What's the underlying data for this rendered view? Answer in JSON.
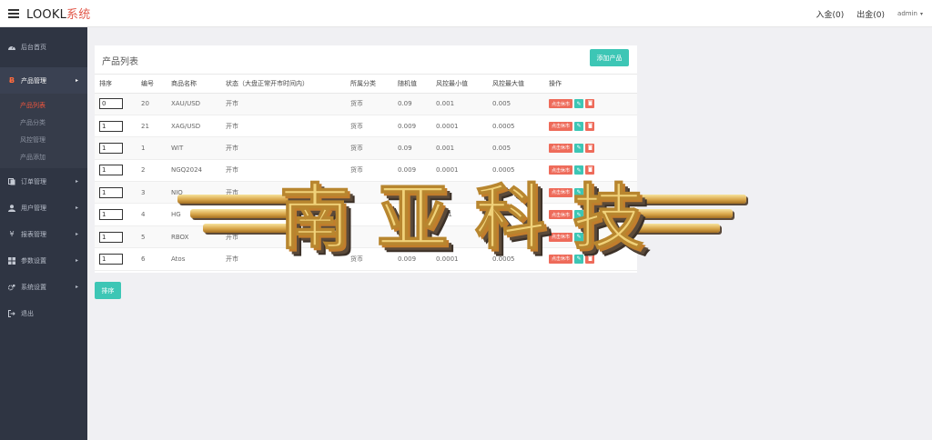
{
  "app": {
    "brand_main": "LOOKL",
    "brand_accent": "系统"
  },
  "topbar": {
    "deposit": "入金(0)",
    "withdraw": "出金(0)",
    "user": "admin"
  },
  "sidebar": {
    "items": [
      {
        "label": "后台首页",
        "icon": "dashboard-icon"
      },
      {
        "label": "产品管理",
        "icon": "bitcoin-icon",
        "active": true,
        "children": [
          {
            "label": "产品列表",
            "current": true
          },
          {
            "label": "产品分类"
          },
          {
            "label": "风控管理"
          },
          {
            "label": "产品添加"
          }
        ]
      },
      {
        "label": "订单管理",
        "icon": "copy-icon"
      },
      {
        "label": "用户管理",
        "icon": "user-icon"
      },
      {
        "label": "报表管理",
        "icon": "yen-icon"
      },
      {
        "label": "参数设置",
        "icon": "grid-icon"
      },
      {
        "label": "系统设置",
        "icon": "gears-icon"
      },
      {
        "label": "退出",
        "icon": "sign-out-icon"
      }
    ]
  },
  "panel": {
    "title": "产品列表",
    "add_button": "添加产品",
    "sort_button": "排序",
    "columns": [
      "排序",
      "编号",
      "商品名称",
      "状态（大盘正常开市时间内）",
      "所属分类",
      "随机值",
      "风控最小值",
      "风控最大值",
      "操作"
    ],
    "rows": [
      {
        "order": "0",
        "id": "20",
        "name": "XAU/USD",
        "status": "开市",
        "category": "货币",
        "random": "0.09",
        "min": "0.001",
        "max": "0.005"
      },
      {
        "order": "1",
        "id": "21",
        "name": "XAG/USD",
        "status": "开市",
        "category": "货币",
        "random": "0.009",
        "min": "0.0001",
        "max": "0.0005"
      },
      {
        "order": "1",
        "id": "1",
        "name": "WIT",
        "status": "开市",
        "category": "货币",
        "random": "0.09",
        "min": "0.001",
        "max": "0.005"
      },
      {
        "order": "1",
        "id": "2",
        "name": "NGQ2024",
        "status": "开市",
        "category": "货币",
        "random": "0.009",
        "min": "0.0001",
        "max": "0.0005"
      },
      {
        "order": "1",
        "id": "3",
        "name": "NIO",
        "status": "开市",
        "category": "",
        "random": "",
        "min": "",
        "max": ""
      },
      {
        "order": "1",
        "id": "4",
        "name": "HG",
        "status": "",
        "category": "",
        "random": "",
        "min": "0001",
        "max": ""
      },
      {
        "order": "1",
        "id": "5",
        "name": "RBOX",
        "status": "开市",
        "category": "",
        "random": "",
        "min": "",
        "max": ""
      },
      {
        "order": "1",
        "id": "6",
        "name": "Atos",
        "status": "开市",
        "category": "货币",
        "random": "0.009",
        "min": "0.0001",
        "max": "0.0005"
      }
    ],
    "op_close_label": "点击休市"
  },
  "watermark": {
    "text": "南亚科技"
  }
}
